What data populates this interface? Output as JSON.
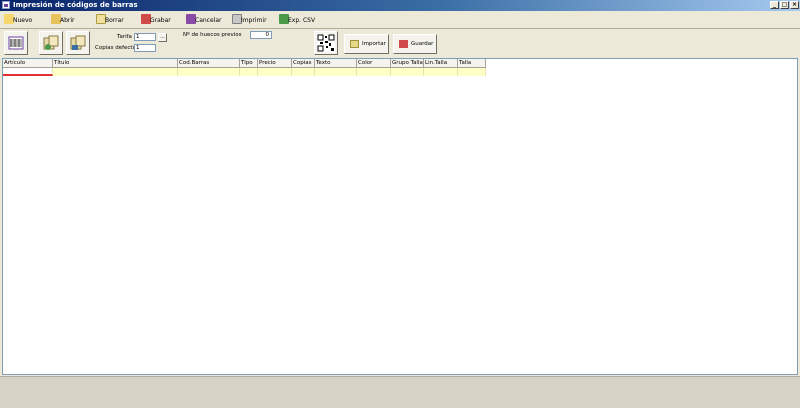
{
  "window": {
    "title": "Impresión de códigos de barras"
  },
  "menu": [
    {
      "label": "Nuevo",
      "icon": "new-icon",
      "color": "#f5d76e"
    },
    {
      "label": "Abrir",
      "icon": "open-icon",
      "color": "#e8c25a"
    },
    {
      "label": "Borrar",
      "icon": "delete-icon",
      "color": "#f0e0a0"
    },
    {
      "label": "Grabar",
      "icon": "save-icon",
      "color": "#d04a4a"
    },
    {
      "label": "Cancelar",
      "icon": "cancel-icon",
      "color": "#8a4aa8"
    },
    {
      "label": "Imprimir",
      "icon": "print-icon",
      "color": "#a0a0a0"
    },
    {
      "label": "Exp. CSV",
      "icon": "export-icon",
      "color": "#4a9a4a"
    }
  ],
  "toolbar": {
    "tarifa_label": "Tarifa",
    "tarifa_value": "1",
    "tarifa_lookup": "...",
    "copias_label": "Copias defecto",
    "copias_value": "1",
    "huecos_label": "Nº de huecos previos",
    "huecos_value": "0",
    "importar_label": "Importar",
    "guardar_label": "Guardar"
  },
  "grid": {
    "columns": [
      "Artículo",
      "Título",
      "Cod.Barras",
      "Tipo",
      "Precio",
      "Copias",
      "Texto",
      "Color",
      "Grupo Talla",
      "Lin.Talla",
      "Talla"
    ],
    "rows": [
      [
        "",
        "",
        "",
        "",
        "",
        "",
        "",
        "",
        "",
        "",
        ""
      ]
    ],
    "row_color": "#ffffc8"
  }
}
